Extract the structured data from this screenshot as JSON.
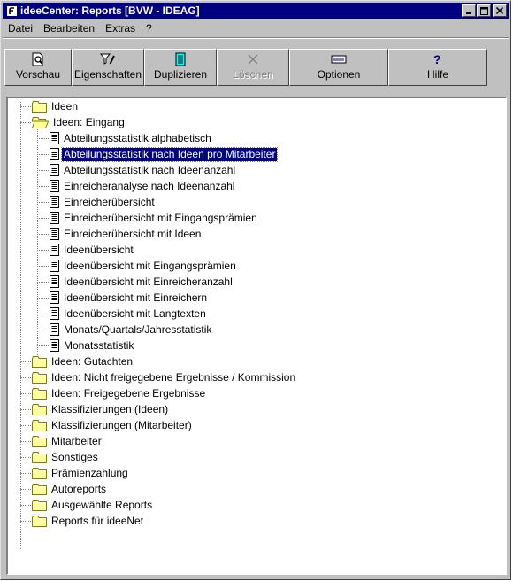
{
  "window": {
    "title": "ideeCenter: Reports [BVW - IDEAG]"
  },
  "menubar": {
    "items": [
      "Datei",
      "Bearbeiten",
      "Extras",
      "?"
    ]
  },
  "toolbar": {
    "buttons": [
      {
        "label": "Vorschau",
        "icon": "preview-icon",
        "enabled": true
      },
      {
        "label": "Eigenschaften",
        "icon": "properties-icon",
        "enabled": true
      },
      {
        "label": "Duplizieren",
        "icon": "duplicate-icon",
        "enabled": true
      },
      {
        "label": "Löschen",
        "icon": "delete-icon",
        "enabled": false
      },
      {
        "label": "Optionen",
        "icon": "options-icon",
        "enabled": true
      },
      {
        "label": "Hilfe",
        "icon": "help-icon",
        "enabled": true
      }
    ]
  },
  "tree": {
    "top_folders_before": [
      {
        "label": "Ideen",
        "open": false
      }
    ],
    "expanded_folder": {
      "label": "Ideen: Eingang",
      "open": true,
      "reports": [
        "Abteilungsstatistik alphabetisch",
        "Abteilungsstatistik nach Ideen pro Mitarbeiter",
        "Abteilungsstatistik nach Ideenanzahl",
        "Einreicheranalyse nach Ideenanzahl",
        "Einreicherübersicht",
        "Einreicherübersicht mit Eingangsprämien",
        "Einreicherübersicht mit Ideen",
        "Ideenübersicht",
        "Ideenübersicht mit Eingangsprämien",
        "Ideenübersicht mit Einreicheranzahl",
        "Ideenübersicht mit Einreichern",
        "Ideenübersicht mit Langtexten",
        "Monats/Quartals/Jahresstatistik",
        "Monatsstatistik"
      ],
      "selected_index": 1
    },
    "top_folders_after": [
      "Ideen: Gutachten",
      "Ideen: Nicht freigegebene Ergebnisse / Kommission",
      "Ideen: Freigegebene Ergebnisse",
      "Klassifizierungen (Ideen)",
      "Klassifizierungen (Mitarbeiter)",
      "Mitarbeiter",
      "Sonstiges",
      "Prämienzahlung",
      "Autoreports",
      "Ausgewählte Reports",
      "Reports für ideeNet"
    ]
  },
  "colors": {
    "titlebar": "#000080",
    "face": "#c0c0c0",
    "selection": "#000080",
    "folder": "#ffff99"
  }
}
